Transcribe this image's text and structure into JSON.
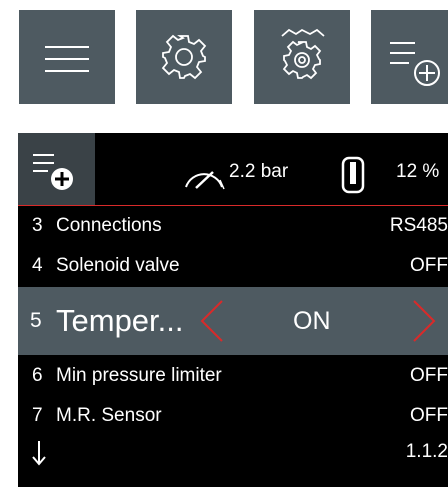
{
  "toolbar": {
    "buttons": [
      {
        "name": "menu-button",
        "icon": "hamburger-menu-icon"
      },
      {
        "name": "settings-button",
        "icon": "gear-icon"
      },
      {
        "name": "advanced-settings-button",
        "icon": "gears-icon"
      },
      {
        "name": "add-list-button",
        "icon": "list-add-icon"
      }
    ]
  },
  "header": {
    "icon_add": "list-add-icon",
    "pressure": {
      "icon": "gauge-icon",
      "value": "2.2 bar"
    },
    "level": {
      "icon": "tank-level-icon",
      "value": "12 %"
    }
  },
  "list": {
    "rows": [
      {
        "number": "3",
        "label": "Connections",
        "value": "RS485"
      },
      {
        "number": "4",
        "label": "Solenoid valve",
        "value": "OFF"
      }
    ],
    "selected": {
      "number": "5",
      "label": "Temper...",
      "value": "ON"
    },
    "rows_after": [
      {
        "number": "6",
        "label": "Min pressure limiter",
        "value": "OFF"
      },
      {
        "number": "7",
        "label": "M.R. Sensor",
        "value": "OFF"
      }
    ],
    "footer": {
      "icon": "arrow-down-icon",
      "version": "1.1.2"
    }
  },
  "colors": {
    "tile": "#4e5a61",
    "panel": "#000000",
    "accent_red": "#d92a2a",
    "text": "#ffffff"
  }
}
